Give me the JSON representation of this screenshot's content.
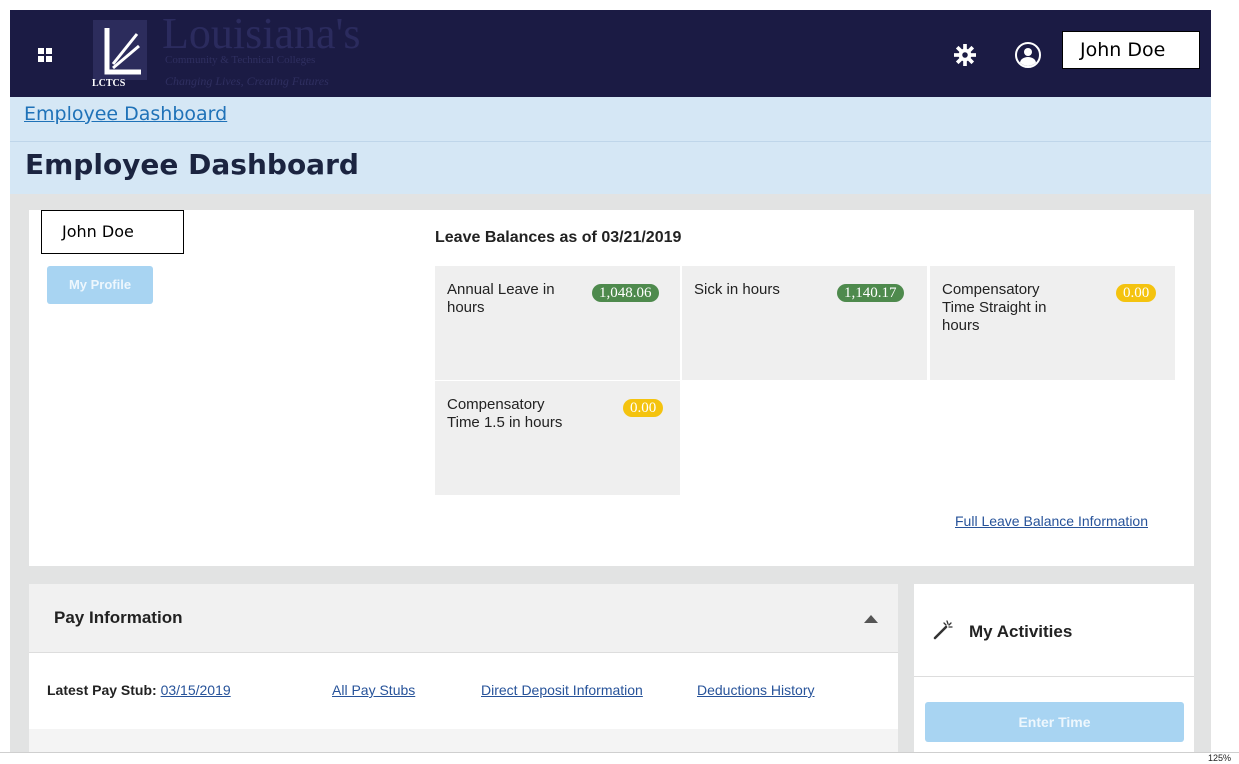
{
  "header": {
    "logo": {
      "title": "Louisiana's",
      "subtitle": "Community & Technical Colleges",
      "tagline": "Changing Lives, Creating Futures",
      "abbreviation": "LCTCS"
    },
    "icons": [
      "grid-icon",
      "gear-icon",
      "user-icon"
    ],
    "user_name": "John Doe"
  },
  "breadcrumb": {
    "link": "Employee Dashboard"
  },
  "page_title": "Employee Dashboard",
  "profile": {
    "name": "John Doe",
    "button_label": "My Profile"
  },
  "leave": {
    "heading": "Leave Balances as of 03/21/2019",
    "tiles": [
      {
        "label": "Annual Leave in hours",
        "value": "1,048.06",
        "status_color": "#4e8a4d"
      },
      {
        "label": "Sick in hours",
        "value": "1,140.17",
        "status_color": "#4e8a4d"
      },
      {
        "label": "Compensatory Time Straight in hours",
        "value": "0.00",
        "status_color": "#f4c30f"
      },
      {
        "label": "Compensatory Time 1.5 in hours",
        "value": "0.00",
        "status_color": "#f4c30f"
      }
    ],
    "full_link": "Full Leave Balance Information"
  },
  "pay": {
    "title": "Pay Information",
    "latest_label": "Latest Pay Stub:",
    "latest_date": "03/15/2019",
    "links": [
      "All Pay Stubs",
      "Direct Deposit Information",
      "Deductions History"
    ]
  },
  "activities": {
    "title": "My Activities",
    "button_label": "Enter Time"
  },
  "status_bar": {
    "zoom": "125%"
  },
  "colors": {
    "header_bg": "#1b1b44",
    "breadcrumb_bg": "#d5e7f5",
    "link": "#27539a",
    "button_disabled": "#a8d4f2"
  }
}
